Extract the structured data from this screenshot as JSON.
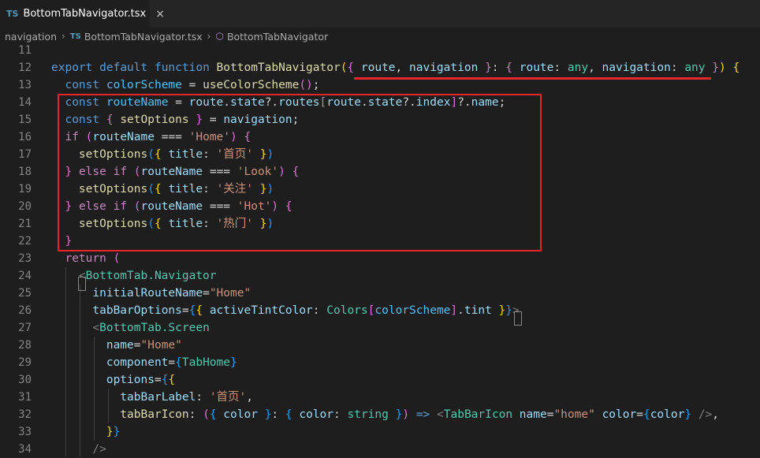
{
  "tab": {
    "badge": "TS",
    "title": "BottomTabNavigator.tsx",
    "close": "×"
  },
  "breadcrumb": {
    "folder": "navigation",
    "file_badge": "TS",
    "file": "BottomTabNavigator.tsx",
    "symbol": "BottomTabNavigator"
  },
  "editor": {
    "line_numbers": [
      "11",
      "12",
      "13",
      "14",
      "15",
      "16",
      "17",
      "18",
      "19",
      "20",
      "21",
      "22",
      "23",
      "24",
      "25",
      "26",
      "27",
      "28",
      "29",
      "30",
      "31",
      "32",
      "33",
      "34"
    ],
    "lines": [
      [],
      [
        [
          "kw",
          "export"
        ],
        [
          "pun",
          " "
        ],
        [
          "kw",
          "default"
        ],
        [
          "pun",
          " "
        ],
        [
          "kw",
          "function"
        ],
        [
          "pun",
          " "
        ],
        [
          "fn",
          "BottomTabNavigator"
        ],
        [
          "b1",
          "("
        ],
        [
          "b2",
          "{"
        ],
        [
          "pun",
          " "
        ],
        [
          "var",
          "route"
        ],
        [
          "pun",
          ", "
        ],
        [
          "var",
          "navigation"
        ],
        [
          "pun",
          " "
        ],
        [
          "b2",
          "}"
        ],
        [
          "pun",
          ": "
        ],
        [
          "b2",
          "{"
        ],
        [
          "pun",
          " "
        ],
        [
          "var",
          "route"
        ],
        [
          "pun",
          ": "
        ],
        [
          "typ",
          "any"
        ],
        [
          "pun",
          ", "
        ],
        [
          "var",
          "navigation"
        ],
        [
          "pun",
          ": "
        ],
        [
          "typ",
          "any"
        ],
        [
          "pun",
          " "
        ],
        [
          "b2",
          "}"
        ],
        [
          "b1",
          ")"
        ],
        [
          "pun",
          " "
        ],
        [
          "b1",
          "{"
        ]
      ],
      [
        [
          "pun",
          "  "
        ],
        [
          "kw",
          "const"
        ],
        [
          "pun",
          " "
        ],
        [
          "cst",
          "colorScheme"
        ],
        [
          "pun",
          " = "
        ],
        [
          "fn",
          "useColorScheme"
        ],
        [
          "b2",
          "("
        ],
        [
          "b2",
          ")"
        ],
        [
          "pun",
          ";"
        ]
      ],
      [
        [
          "pun",
          "  "
        ],
        [
          "kw",
          "const"
        ],
        [
          "pun",
          " "
        ],
        [
          "cst",
          "routeName"
        ],
        [
          "pun",
          " = "
        ],
        [
          "var",
          "route"
        ],
        [
          "pun",
          "."
        ],
        [
          "var",
          "state"
        ],
        [
          "pun",
          "?."
        ],
        [
          "var",
          "routes"
        ],
        [
          "b2",
          "["
        ],
        [
          "var",
          "route"
        ],
        [
          "pun",
          "."
        ],
        [
          "var",
          "state"
        ],
        [
          "pun",
          "?."
        ],
        [
          "var",
          "index"
        ],
        [
          "b2",
          "]"
        ],
        [
          "pun",
          "?."
        ],
        [
          "var",
          "name"
        ],
        [
          "pun",
          ";"
        ]
      ],
      [
        [
          "pun",
          "  "
        ],
        [
          "kw",
          "const"
        ],
        [
          "pun",
          " "
        ],
        [
          "b2",
          "{"
        ],
        [
          "pun",
          " "
        ],
        [
          "fn",
          "setOptions"
        ],
        [
          "pun",
          " "
        ],
        [
          "b2",
          "}"
        ],
        [
          "pun",
          " = "
        ],
        [
          "var",
          "navigation"
        ],
        [
          "pun",
          ";"
        ]
      ],
      [
        [
          "pun",
          "  "
        ],
        [
          "ctl",
          "if"
        ],
        [
          "pun",
          " "
        ],
        [
          "b2",
          "("
        ],
        [
          "var",
          "routeName"
        ],
        [
          "pun",
          " === "
        ],
        [
          "str",
          "'Home'"
        ],
        [
          "b2",
          ")"
        ],
        [
          "pun",
          " "
        ],
        [
          "b2",
          "{"
        ]
      ],
      [
        [
          "pun",
          "    "
        ],
        [
          "fn",
          "setOptions"
        ],
        [
          "b3",
          "("
        ],
        [
          "b1",
          "{"
        ],
        [
          "pun",
          " "
        ],
        [
          "var",
          "title"
        ],
        [
          "pun",
          ": "
        ],
        [
          "str",
          "'首页'"
        ],
        [
          "pun",
          " "
        ],
        [
          "b1",
          "}"
        ],
        [
          "b3",
          ")"
        ]
      ],
      [
        [
          "pun",
          "  "
        ],
        [
          "b2",
          "}"
        ],
        [
          "pun",
          " "
        ],
        [
          "ctl",
          "else"
        ],
        [
          "pun",
          " "
        ],
        [
          "ctl",
          "if"
        ],
        [
          "pun",
          " "
        ],
        [
          "b2",
          "("
        ],
        [
          "var",
          "routeName"
        ],
        [
          "pun",
          " === "
        ],
        [
          "str",
          "'Look'"
        ],
        [
          "b2",
          ")"
        ],
        [
          "pun",
          " "
        ],
        [
          "b2",
          "{"
        ]
      ],
      [
        [
          "pun",
          "    "
        ],
        [
          "fn",
          "setOptions"
        ],
        [
          "b3",
          "("
        ],
        [
          "b1",
          "{"
        ],
        [
          "pun",
          " "
        ],
        [
          "var",
          "title"
        ],
        [
          "pun",
          ": "
        ],
        [
          "str",
          "'关注'"
        ],
        [
          "pun",
          " "
        ],
        [
          "b1",
          "}"
        ],
        [
          "b3",
          ")"
        ]
      ],
      [
        [
          "pun",
          "  "
        ],
        [
          "b2",
          "}"
        ],
        [
          "pun",
          " "
        ],
        [
          "ctl",
          "else"
        ],
        [
          "pun",
          " "
        ],
        [
          "ctl",
          "if"
        ],
        [
          "pun",
          " "
        ],
        [
          "b2",
          "("
        ],
        [
          "var",
          "routeName"
        ],
        [
          "pun",
          " === "
        ],
        [
          "str",
          "'Hot'"
        ],
        [
          "b2",
          ")"
        ],
        [
          "pun",
          " "
        ],
        [
          "b2",
          "{"
        ]
      ],
      [
        [
          "pun",
          "    "
        ],
        [
          "fn",
          "setOptions"
        ],
        [
          "b3",
          "("
        ],
        [
          "b1",
          "{"
        ],
        [
          "pun",
          " "
        ],
        [
          "var",
          "title"
        ],
        [
          "pun",
          ": "
        ],
        [
          "str",
          "'热门'"
        ],
        [
          "pun",
          " "
        ],
        [
          "b1",
          "}"
        ],
        [
          "b3",
          ")"
        ]
      ],
      [
        [
          "pun",
          "  "
        ],
        [
          "b2",
          "}"
        ]
      ],
      [
        [
          "pun",
          "  "
        ],
        [
          "ctl",
          "return"
        ],
        [
          "pun",
          " "
        ],
        [
          "b2",
          "("
        ]
      ],
      [
        [
          "pun",
          "    "
        ],
        [
          "ang",
          "<"
        ],
        [
          "tag",
          "BottomTab.Navigator"
        ]
      ],
      [
        [
          "pun",
          "      "
        ],
        [
          "var",
          "initialRouteName"
        ],
        [
          "pun",
          "="
        ],
        [
          "str",
          "\"Home\""
        ]
      ],
      [
        [
          "pun",
          "      "
        ],
        [
          "var",
          "tabBarOptions"
        ],
        [
          "pun",
          "="
        ],
        [
          "b3",
          "{"
        ],
        [
          "b1",
          "{"
        ],
        [
          "pun",
          " "
        ],
        [
          "var",
          "activeTintColor"
        ],
        [
          "pun",
          ": "
        ],
        [
          "typ",
          "Colors"
        ],
        [
          "b2",
          "["
        ],
        [
          "cst",
          "colorScheme"
        ],
        [
          "b2",
          "]"
        ],
        [
          "pun",
          "."
        ],
        [
          "var",
          "tint"
        ],
        [
          "pun",
          " "
        ],
        [
          "b1",
          "}"
        ],
        [
          "b3",
          "}"
        ],
        [
          "ang",
          ">"
        ]
      ],
      [
        [
          "pun",
          "      "
        ],
        [
          "ang",
          "<"
        ],
        [
          "tag",
          "BottomTab.Screen"
        ]
      ],
      [
        [
          "pun",
          "        "
        ],
        [
          "var",
          "name"
        ],
        [
          "pun",
          "="
        ],
        [
          "str",
          "\"Home\""
        ]
      ],
      [
        [
          "pun",
          "        "
        ],
        [
          "var",
          "component"
        ],
        [
          "pun",
          "="
        ],
        [
          "b3",
          "{"
        ],
        [
          "typ",
          "TabHome"
        ],
        [
          "b3",
          "}"
        ]
      ],
      [
        [
          "pun",
          "        "
        ],
        [
          "var",
          "options"
        ],
        [
          "pun",
          "="
        ],
        [
          "b3",
          "{"
        ],
        [
          "b1",
          "{"
        ]
      ],
      [
        [
          "pun",
          "          "
        ],
        [
          "var",
          "tabBarLabel"
        ],
        [
          "pun",
          ": "
        ],
        [
          "str",
          "'首页'"
        ],
        [
          "pun",
          ","
        ]
      ],
      [
        [
          "pun",
          "          "
        ],
        [
          "fn",
          "tabBarIcon"
        ],
        [
          "pun",
          ": "
        ],
        [
          "b2",
          "("
        ],
        [
          "b3",
          "{"
        ],
        [
          "pun",
          " "
        ],
        [
          "var",
          "color"
        ],
        [
          "pun",
          " "
        ],
        [
          "b3",
          "}"
        ],
        [
          "pun",
          ": "
        ],
        [
          "b3",
          "{"
        ],
        [
          "pun",
          " "
        ],
        [
          "var",
          "color"
        ],
        [
          "pun",
          ": "
        ],
        [
          "typ",
          "string"
        ],
        [
          "pun",
          " "
        ],
        [
          "b3",
          "}"
        ],
        [
          "b2",
          ")"
        ],
        [
          "pun",
          " "
        ],
        [
          "kw",
          "=>"
        ],
        [
          "pun",
          " "
        ],
        [
          "ang",
          "<"
        ],
        [
          "tag",
          "TabBarIcon"
        ],
        [
          "pun",
          " "
        ],
        [
          "var",
          "name"
        ],
        [
          "pun",
          "="
        ],
        [
          "str",
          "\"home\""
        ],
        [
          "pun",
          " "
        ],
        [
          "var",
          "color"
        ],
        [
          "pun",
          "="
        ],
        [
          "b3",
          "{"
        ],
        [
          "var",
          "color"
        ],
        [
          "b3",
          "}"
        ],
        [
          "pun",
          " "
        ],
        [
          "ang",
          "/>"
        ],
        [
          "pun",
          ","
        ]
      ],
      [
        [
          "pun",
          "        "
        ],
        [
          "b1",
          "}"
        ],
        [
          "b3",
          "}"
        ]
      ],
      [
        [
          "pun",
          "      "
        ],
        [
          "ang",
          "/>"
        ]
      ]
    ]
  },
  "annotations": {
    "highlight_color": "#e5252a"
  }
}
